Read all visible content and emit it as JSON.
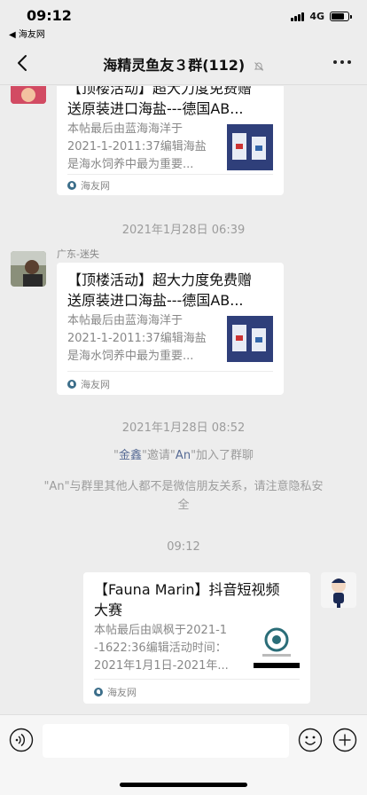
{
  "status_bar": {
    "time": "09:12",
    "back_app": "◀ 海友网",
    "network": "4G",
    "battery_level": 0.8
  },
  "nav": {
    "title": "海精灵鱼友３群(112)",
    "icons": [
      "back-chevron-icon",
      "mute-bell-icon",
      "more-dots-icon"
    ]
  },
  "messages": [
    {
      "type": "card",
      "card": {
        "title_lines": [
          "【顶楼活动】超大力度免费赠",
          "送原装进口海盐---德国AB..."
        ],
        "desc_lines": [
          "本帖最后由蓝海海洋于",
          "2021-1-2011:37编辑海盐",
          "是海水饲养中最为重要..."
        ],
        "source": "海友网"
      }
    },
    {
      "type": "time",
      "text": "2021年1月28日 06:39"
    },
    {
      "type": "card",
      "sender": "广东-迷失",
      "card": {
        "title_lines": [
          "【顶楼活动】超大力度免费赠",
          "送原装进口海盐---德国AB..."
        ],
        "desc_lines": [
          "本帖最后由蓝海海洋于",
          "2021-1-2011:37编辑海盐",
          "是海水饲养中最为重要..."
        ],
        "source": "海友网"
      }
    },
    {
      "type": "time",
      "text": "2021年1月28日 08:52"
    },
    {
      "type": "system",
      "parts": {
        "q1": "\"",
        "inviter": "金鑫",
        "mid": "\"邀请\"",
        "invitee": "An",
        "tail": "\"加入了群聊"
      }
    },
    {
      "type": "system",
      "line1": "\"An\"与群里其他人都不是微信朋友关系，请注意隐私安",
      "line2": "全"
    },
    {
      "type": "time",
      "text": "09:12"
    },
    {
      "type": "card",
      "from_me": true,
      "card": {
        "title_lines": [
          "【Fauna Marin】抖音短视频",
          "大赛"
        ],
        "desc_lines": [
          "本帖最后由飒枫于2021-1",
          "-1622:36编辑活动时间：",
          "2021年1月1日-2021年..."
        ],
        "source": "海友网"
      }
    }
  ],
  "input_bar": {
    "placeholder": "",
    "icons": [
      "voice-icon",
      "emoji-icon",
      "plus-icon"
    ]
  },
  "colors": {
    "background": "#ededed",
    "card": "#ffffff",
    "link_name": "#576b95",
    "muted_text": "#9c9c9c"
  }
}
